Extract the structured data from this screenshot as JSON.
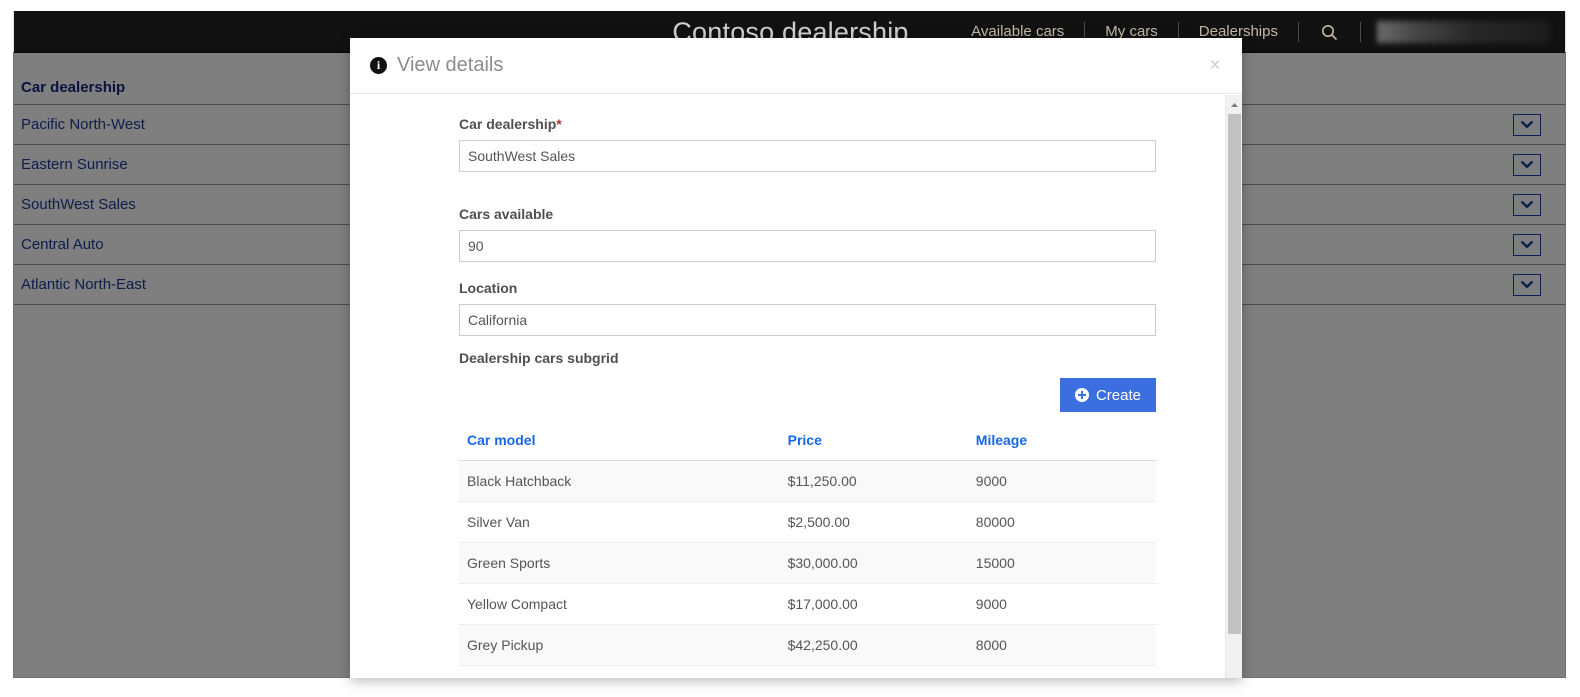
{
  "site": {
    "brand": "Contoso dealership",
    "nav": {
      "items": [
        {
          "label": "Available cars"
        },
        {
          "label": "My cars"
        },
        {
          "label": "Dealerships"
        }
      ],
      "search_icon": "search-icon",
      "user_label": ""
    },
    "list": {
      "header": "Car dealership",
      "rows": [
        {
          "name": "Pacific North-West"
        },
        {
          "name": "Eastern Sunrise"
        },
        {
          "name": "SouthWest Sales"
        },
        {
          "name": "Central Auto"
        },
        {
          "name": "Atlantic North-East"
        }
      ],
      "row_action_icon": "chevron-down-icon"
    }
  },
  "modal": {
    "icon": "info-icon",
    "title": "View details",
    "close_label": "×",
    "fields": [
      {
        "label": "Car dealership",
        "required": true,
        "required_marker": "*",
        "value": "SouthWest Sales",
        "placeholder": ""
      },
      {
        "label": "Cars available",
        "required": false,
        "value": "90",
        "placeholder": ""
      },
      {
        "label": "Location",
        "required": false,
        "value": "California",
        "placeholder": ""
      }
    ],
    "subgrid": {
      "label": "Dealership cars subgrid",
      "create_button": {
        "label": "Create",
        "icon": "plus-circle-icon"
      },
      "columns": [
        "Car model",
        "Price",
        "Mileage"
      ],
      "rows": [
        {
          "model": "Black Hatchback",
          "price": "$11,250.00",
          "mileage": "9000"
        },
        {
          "model": "Silver Van",
          "price": "$2,500.00",
          "mileage": "80000"
        },
        {
          "model": "Green Sports",
          "price": "$30,000.00",
          "mileage": "15000"
        },
        {
          "model": "Yellow Compact",
          "price": "$17,000.00",
          "mileage": "9000"
        },
        {
          "model": "Grey Pickup",
          "price": "$42,250.00",
          "mileage": "8000"
        }
      ]
    },
    "scrollbar": {
      "up_arrow_icon": "caret-up-icon"
    }
  },
  "colors": {
    "header_bg": "#111111",
    "nav_link": "#c4b9a4",
    "accent_blue": "#1867e8",
    "create_button": "#3b6fe0",
    "list_link": "#1c3c96",
    "required_red": "#b03030"
  }
}
